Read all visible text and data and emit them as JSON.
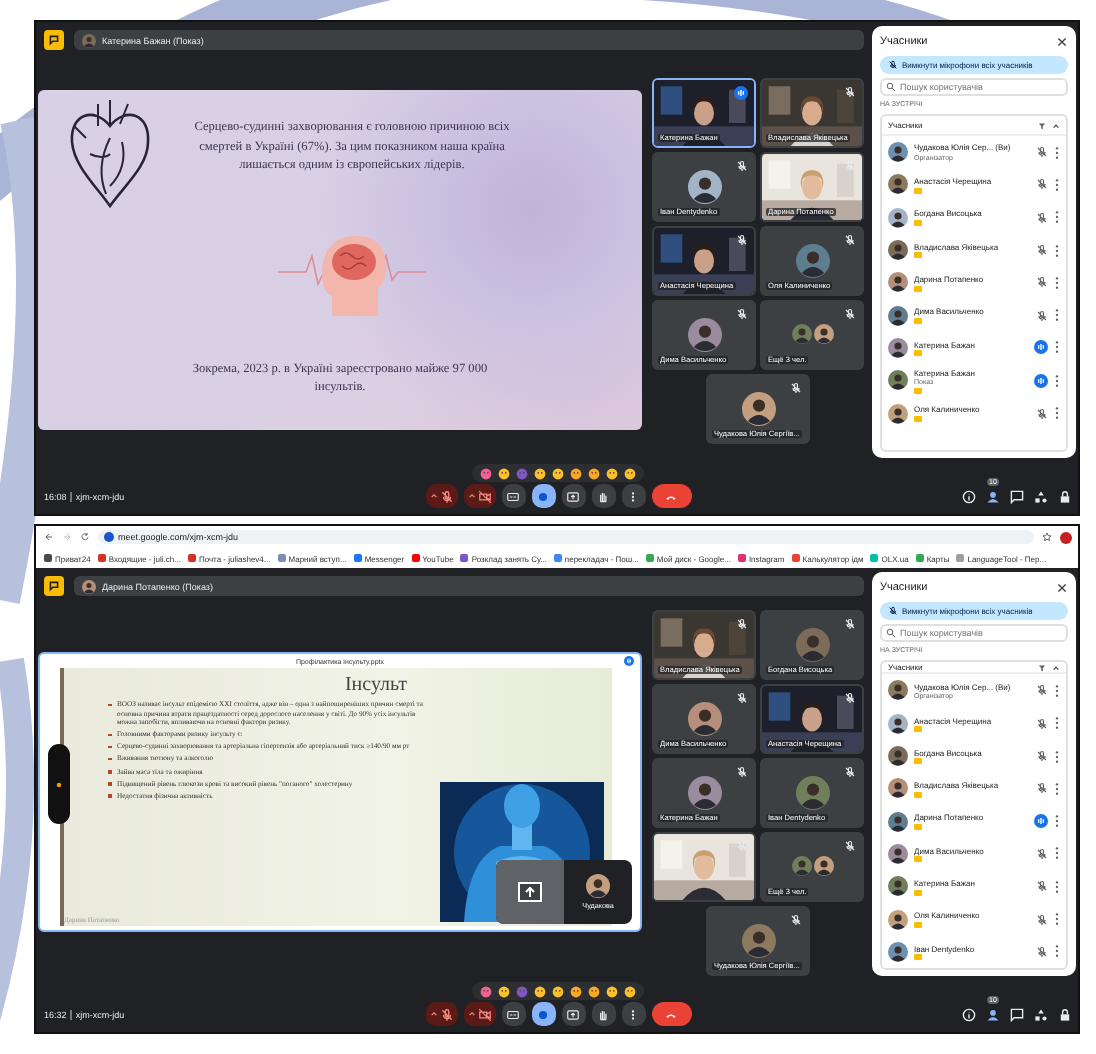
{
  "shots": [
    {
      "presenter": "Катерина Бажан (Показ)",
      "slide": {
        "kind": "poster",
        "paragraphs": [
          "Серцево-судинні захворювання є головною причиною всіх смертей в Україні (67%). За цим показником наша країна лишається одним із європейських лідерів.",
          "Зокрема, 2023 р. в Україні зареєстровано майже 97 000 інсультів."
        ]
      },
      "tiles": [
        {
          "kind": "video",
          "name": "Катерина Бажан",
          "speaking": true
        },
        {
          "kind": "video",
          "name": "Владислава Яківецька",
          "speaking": false
        },
        {
          "kind": "avatar",
          "name": "Іван Dentydenko",
          "speaking": false
        },
        {
          "kind": "video",
          "name": "Дарина Потапенко",
          "speaking": false
        },
        {
          "kind": "video",
          "name": "Анастасія Черещина",
          "speaking": false
        },
        {
          "kind": "avatar",
          "name": "Оля Калиниченко",
          "speaking": false
        },
        {
          "kind": "avatar",
          "name": "Дима Васильченко",
          "speaking": false
        },
        {
          "kind": "group",
          "name": "Ещё 3 чел.",
          "speaking": false
        },
        {
          "kind": "avatar",
          "name": "Чудакова Юлія Сергіїв...",
          "speaking": false
        }
      ],
      "panel": {
        "title": "Учасники",
        "mute_all": "Вимкнути мікрофони всіх учасників",
        "search_placeholder": "Пошук користувачів",
        "section": "НА ЗУСТРІЧІ",
        "group": "Учасники",
        "people": [
          {
            "name": "Чудакова Юлія Сер... (Ви)",
            "role": "Організатор",
            "badge": false,
            "speaking": false
          },
          {
            "name": "Анастасія Черещина",
            "badge": true,
            "speaking": false
          },
          {
            "name": "Богдана Висоцька",
            "badge": true,
            "speaking": false
          },
          {
            "name": "Владислава Яківецька",
            "badge": true,
            "speaking": false
          },
          {
            "name": "Дарина Потапенко",
            "badge": true,
            "speaking": false
          },
          {
            "name": "Дима Васильченко",
            "badge": true,
            "speaking": false
          },
          {
            "name": "Катерина Бажан",
            "badge": true,
            "speaking": true
          },
          {
            "name": "Катерина Бажан",
            "role": "Показ",
            "badge": true,
            "speaking": true
          },
          {
            "name": "Оля Калиниченко",
            "badge": true,
            "speaking": false
          }
        ]
      },
      "bottom": {
        "time": "16:08",
        "code": "xjm-xcm-jdu",
        "people_count": "10"
      },
      "controls": [
        {
          "kind": "mic",
          "on": false
        },
        {
          "kind": "camera",
          "on": false
        },
        {
          "kind": "captions",
          "on": false
        },
        {
          "kind": "reactions",
          "on": true
        },
        {
          "kind": "present",
          "on": false
        },
        {
          "kind": "hand",
          "on": false
        },
        {
          "kind": "more"
        },
        {
          "kind": "leave"
        }
      ]
    },
    {
      "browser": {
        "url": "meet.google.com/xjm-xcm-jdu",
        "bookmarks": [
          "Приват24",
          "Входящие - juli.ch...",
          "Почта - juliashev4...",
          "Марний вступ...",
          "Messenger",
          "YouTube",
          "Розклад занять Су...",
          "перекладач - Пош...",
          "Мой диск - Google...",
          "Instagram",
          "Калькулятор ідм",
          "OLX.ua",
          "Карты",
          "LanguageTool - Пер..."
        ]
      },
      "presenter": "Дарина Потапенко (Показ)",
      "slide": {
        "kind": "window",
        "window_title": "Профілактика інсульту.pptx",
        "heading": "Інсульт",
        "bullets": [
          "ВООЗ називає інсульт епідемією XXI століття, адже він – одна з найпоширеніших причин смерті та основна причина втрати працездатності серед дорослого населення у світі. До 90% усіх інсультів можна запобігти, впливаючи на основні фактори ризику.",
          "Головними факторами ризику інсульту є:",
          "Серцево-судинні захворювання та артеріальна гіпертензія або артеріальний тиск ≥140/90 мм рт",
          "Вживання тютюну та алкоголю",
          "Зайва маса тіла та ожиріння",
          "Підвищений рівень глюкози крові та високий рівень \"поганого\" холестерину",
          "Недостатня фізична активність"
        ],
        "presenter_label": "Дарина Потапенко",
        "self_view": "Чудакова"
      },
      "tiles": [
        {
          "kind": "video",
          "name": "Владислава Яківецька",
          "speaking": false
        },
        {
          "kind": "avatar",
          "name": "Богдана Висоцька",
          "speaking": false
        },
        {
          "kind": "avatar",
          "name": "Дима Васильченко",
          "speaking": false
        },
        {
          "kind": "video",
          "name": "Анастасія Черещина",
          "speaking": false
        },
        {
          "kind": "avatar",
          "name": "Катерина Бажан",
          "speaking": false
        },
        {
          "kind": "avatar",
          "name": "Іван Dentydenko",
          "speaking": false
        },
        {
          "kind": "video",
          "speaking": false
        },
        {
          "kind": "group",
          "name": "Ещё 3 чел.",
          "speaking": false
        },
        {
          "kind": "avatar",
          "name": "Чудакова Юлія Сергіїв...",
          "speaking": false
        }
      ],
      "panel": {
        "title": "Учасники",
        "mute_all": "Вимкнути мікрофони всіх учасників",
        "search_placeholder": "Пошук користувачів",
        "section": "НА ЗУСТРІЧІ",
        "group": "Учасники",
        "people": [
          {
            "name": "Чудакова Юлія Сер... (Ви)",
            "role": "Організатор",
            "badge": false,
            "speaking": false
          },
          {
            "name": "Анастасія Черещина",
            "badge": true,
            "speaking": false
          },
          {
            "name": "Богдана Висоцька",
            "badge": true,
            "speaking": false
          },
          {
            "name": "Владислава Яківецька",
            "badge": true,
            "speaking": false
          },
          {
            "name": "Дарина Потапенко",
            "badge": true,
            "speaking": true
          },
          {
            "name": "Дима Васильченко",
            "badge": true,
            "speaking": false
          },
          {
            "name": "Катерина Бажан",
            "badge": true,
            "speaking": false
          },
          {
            "name": "Оля Калиниченко",
            "badge": true,
            "speaking": false
          },
          {
            "name": "Іван Dentydenko",
            "badge": true,
            "speaking": false
          }
        ]
      },
      "bottom": {
        "time": "16:32",
        "code": "xjm-xcm-jdu",
        "people_count": "10"
      },
      "controls": [
        {
          "kind": "mic",
          "on": false
        },
        {
          "kind": "camera",
          "on": false
        },
        {
          "kind": "captions",
          "on": false
        },
        {
          "kind": "reactions",
          "on": true
        },
        {
          "kind": "present",
          "on": false
        },
        {
          "kind": "hand",
          "on": false
        },
        {
          "kind": "more"
        },
        {
          "kind": "leave"
        }
      ]
    }
  ]
}
